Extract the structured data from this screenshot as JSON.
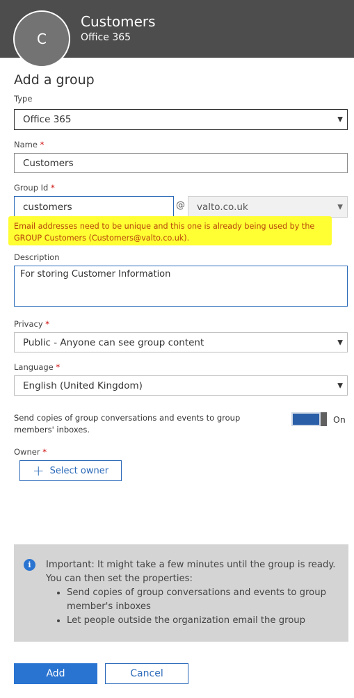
{
  "header": {
    "avatar_letter": "C",
    "title": "Customers",
    "subtitle": "Office 365"
  },
  "form": {
    "title": "Add a group",
    "type": {
      "label": "Type",
      "value": "Office 365"
    },
    "name": {
      "label": "Name",
      "required_mark": "*",
      "value": "Customers"
    },
    "group_id": {
      "label": "Group Id",
      "required_mark": "*",
      "value": "customers",
      "at": "@",
      "domain": "valto.co.uk",
      "error": "Email addresses need to be unique and this one is already being used by the GROUP Customers (Customers@valto.co.uk)."
    },
    "description": {
      "label": "Description",
      "value": "For storing Customer Information"
    },
    "privacy": {
      "label": "Privacy",
      "required_mark": "*",
      "value": "Public - Anyone can see group content"
    },
    "language": {
      "label": "Language",
      "required_mark": "*",
      "value": "English (United Kingdom)"
    },
    "send_copies": {
      "text": "Send copies of group conversations and events to group members' inboxes.",
      "state": "On",
      "enabled": true
    },
    "owner": {
      "label": "Owner",
      "required_mark": "*",
      "button": "Select owner"
    }
  },
  "info": {
    "line1": "Important: It might take a few minutes until the group is ready.",
    "line2": "You can then set the properties:",
    "items": [
      "Send copies of group conversations and events to group member's inboxes",
      "Let people outside the organization email the group"
    ]
  },
  "actions": {
    "add": "Add",
    "cancel": "Cancel"
  },
  "colors": {
    "accent": "#2a74d1",
    "header_bg": "#4d4d4d",
    "error": "#b7430a",
    "highlight": "#ffff33"
  }
}
